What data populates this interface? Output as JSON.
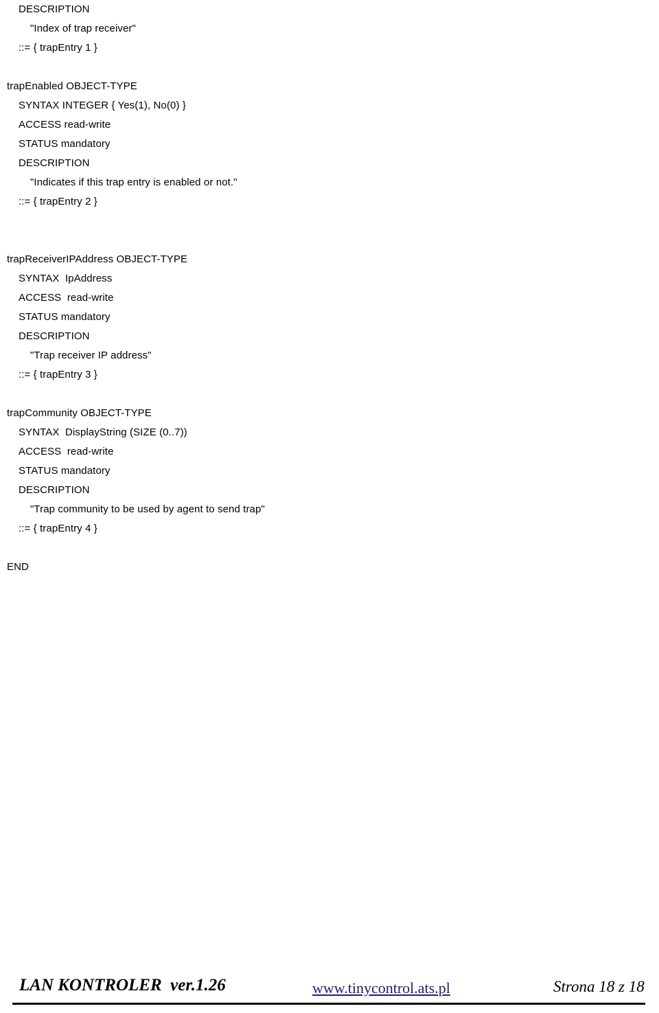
{
  "document": {
    "lines": [
      {
        "text": "DESCRIPTION",
        "indent": 1
      },
      {
        "text": "\"Index of trap receiver\"",
        "indent": 2
      },
      {
        "text": "::= { trapEntry 1 }",
        "indent": 1
      },
      {
        "text": "",
        "indent": 0
      },
      {
        "text": "trapEnabled OBJECT-TYPE",
        "indent": 0
      },
      {
        "text": "SYNTAX INTEGER { Yes(1), No(0) }",
        "indent": 1
      },
      {
        "text": "ACCESS read-write",
        "indent": 1
      },
      {
        "text": "STATUS mandatory",
        "indent": 1
      },
      {
        "text": "DESCRIPTION",
        "indent": 1
      },
      {
        "text": "\"Indicates if this trap entry is enabled or not.\"",
        "indent": 2
      },
      {
        "text": "::= { trapEntry 2 }",
        "indent": 1
      },
      {
        "text": "",
        "indent": 0
      },
      {
        "text": "",
        "indent": 0
      },
      {
        "text": "trapReceiverIPAddress OBJECT-TYPE",
        "indent": 0
      },
      {
        "text": "SYNTAX  IpAddress",
        "indent": 1
      },
      {
        "text": "ACCESS  read-write",
        "indent": 1
      },
      {
        "text": "STATUS mandatory",
        "indent": 1
      },
      {
        "text": "DESCRIPTION",
        "indent": 1
      },
      {
        "text": "\"Trap receiver IP address\"",
        "indent": 2
      },
      {
        "text": "::= { trapEntry 3 }",
        "indent": 1
      },
      {
        "text": "",
        "indent": 0
      },
      {
        "text": "trapCommunity OBJECT-TYPE",
        "indent": 0
      },
      {
        "text": "SYNTAX  DisplayString (SIZE (0..7))",
        "indent": 1
      },
      {
        "text": "ACCESS  read-write",
        "indent": 1
      },
      {
        "text": "STATUS mandatory",
        "indent": 1
      },
      {
        "text": "DESCRIPTION",
        "indent": 1
      },
      {
        "text": "\"Trap community to be used by agent to send trap\"",
        "indent": 2
      },
      {
        "text": "::= { trapEntry 4 }",
        "indent": 1
      },
      {
        "text": "",
        "indent": 0
      },
      {
        "text": "END",
        "indent": 0
      }
    ]
  },
  "footer": {
    "left_label": "LAN KONTROLER  ver.1.26",
    "link_label": "www.tinycontrol.ats.pl",
    "link_color": "#1f1f6e",
    "page_label": "Strona 18 z 18"
  }
}
